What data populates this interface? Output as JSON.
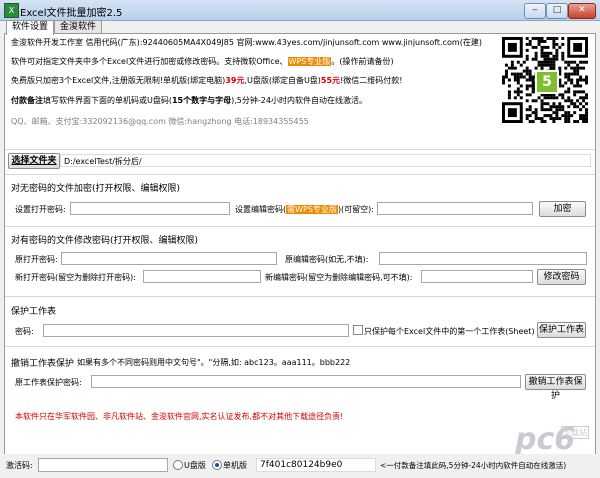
{
  "window": {
    "title": "Excel文件批量加密2.5",
    "minimize": "‒",
    "maximize": "□",
    "close": "✕"
  },
  "tabs": [
    "软件设置",
    "金浚软件"
  ],
  "info": {
    "line1": "金浚软件开发工作室 信用代码(广东):92440605MA4X049J85 官网:www.43yes.com/jinjunsoft.com www.jinjunsoft.com(在建)",
    "line2a": "软件可对指定文件夹中多个Excel文件进行加密或修改密码。支持微软Office、",
    "line2b": "WPS专业版",
    "line2c": "。(操作前请备份)",
    "line3a": "免费版只加密3个Excel文件,注册版无限制!单机版(绑定电脑)",
    "line3b": "39元",
    "line3c": ",U盘版(绑定自备U盘)",
    "line3d": "55元",
    "line3e": "!微信二维码付款!",
    "line4a": "付款备注",
    "line4b": "填写软件界面下面的单机码或U盘码(",
    "line4c": "15个数字与字母",
    "line4d": "),5分钟-24小时内软件自动在线激活。",
    "line5": "QQ、邮箱、支付宝:332092136@qq.com   微信:hangzhong   电话:18934355455"
  },
  "folder": {
    "button": "选择文件夹",
    "path": "D:/excelTest/拆分后/"
  },
  "encrypt": {
    "title": "对无密码的文件加密(打开权限、编辑权限)",
    "open_label": "设置打开密码:",
    "edit_label_a": "设置编辑密码(",
    "edit_label_b": "需WPS专业版",
    "edit_label_c": ")(可留空):",
    "button": "加密"
  },
  "modify": {
    "title": "对有密码的文件修改密码(打开权限、编辑权限)",
    "orig_open": "原打开密码:",
    "orig_edit": "原编辑密码(如无,不填):",
    "new_open": "新打开密码(留空为删除打开密码):",
    "new_edit": "新编辑密码(留空为删除编辑密码,可不填):",
    "button": "修改密码"
  },
  "protect": {
    "title": "保护工作表",
    "pwd_label": "密码:",
    "checkbox_label": "只保护每个Excel文件中的第一个工作表(Sheet)",
    "button": "保护工作表"
  },
  "unprotect": {
    "title": "撤销工作表保护",
    "hint": "如果有多个不同密码则用中文句号\"。\"分隔,如: abc123。aaa111。bbb222",
    "label": "原工作表保护密码:",
    "button": "撤销工作表保护"
  },
  "notice": "本软件只在华军软件园、非凡软件站、金浚软件官网,实名认证发布,都不对其他下载途径负责!",
  "status": {
    "activation_label": "激活码:",
    "usb_label": "U盘版",
    "standalone_label": "单机版",
    "machine_code": "7f401c80124b9e0",
    "hint": "<一付款备注填此码,5分钟-24小时内软件自动在线激活)",
    "selected": "单机版"
  },
  "qr_badge": "5",
  "watermark": "pc6",
  "watermark_sub": "下载站",
  "colors": {
    "red": "#d40000",
    "orange": "#f08a00",
    "qr_accent": "#7dbf2e"
  }
}
